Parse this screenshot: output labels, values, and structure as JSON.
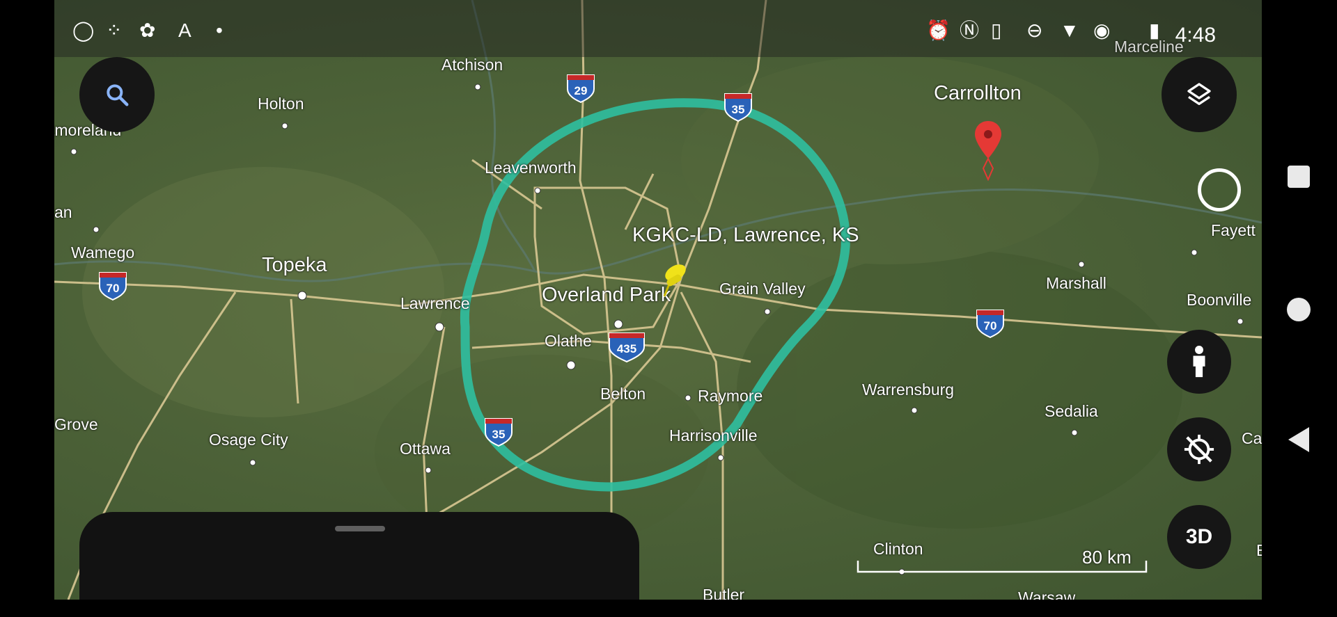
{
  "status_bar": {
    "time": "4:48",
    "extra_label": "Marceline"
  },
  "map": {
    "places": [
      {
        "name": "Atchison"
      },
      {
        "name": "Holton"
      },
      {
        "name": "tmoreland"
      },
      {
        "name": "an"
      },
      {
        "name": "Wamego"
      },
      {
        "name": "Topeka"
      },
      {
        "name": "Lawrence"
      },
      {
        "name": "Leavenworth"
      },
      {
        "name": "Overland Park"
      },
      {
        "name": "Olathe"
      },
      {
        "name": "Grain Valley"
      },
      {
        "name": "Belton"
      },
      {
        "name": "Raymore"
      },
      {
        "name": "Harrisonville"
      },
      {
        "name": "Grove"
      },
      {
        "name": "Osage City"
      },
      {
        "name": "Ottawa"
      },
      {
        "name": "Carrollton"
      },
      {
        "name": "Fayett"
      },
      {
        "name": "Marshall"
      },
      {
        "name": "Boonville"
      },
      {
        "name": "Warrensburg"
      },
      {
        "name": "Sedalia"
      },
      {
        "name": "Ca"
      },
      {
        "name": "Clinton"
      },
      {
        "name": "Butler"
      },
      {
        "name": "Warsaw"
      },
      {
        "name": "E"
      }
    ],
    "placemark_label": "KGKC-LD, Lawrence, KS",
    "highway_shields": [
      "29",
      "35",
      "70",
      "70",
      "435",
      "35"
    ],
    "scale_label": "80 km",
    "coverage_circle_color": "#2fbfa0",
    "pin_color": "#f0e21a",
    "marker_color": "#e53935"
  },
  "controls": {
    "search": {
      "icon": "search-icon"
    },
    "layers": {
      "icon": "layers-icon"
    },
    "compass": {
      "icon": "compass-ring-icon"
    },
    "pegman": {
      "icon": "pegman-icon"
    },
    "location": {
      "icon": "location-disabled-icon"
    },
    "view_3d": {
      "label": "3D"
    }
  },
  "nav_bar": {
    "square": {
      "icon": "recents-square-icon"
    },
    "home": {
      "icon": "home-circle-icon"
    },
    "back": {
      "icon": "back-triangle-icon"
    }
  }
}
